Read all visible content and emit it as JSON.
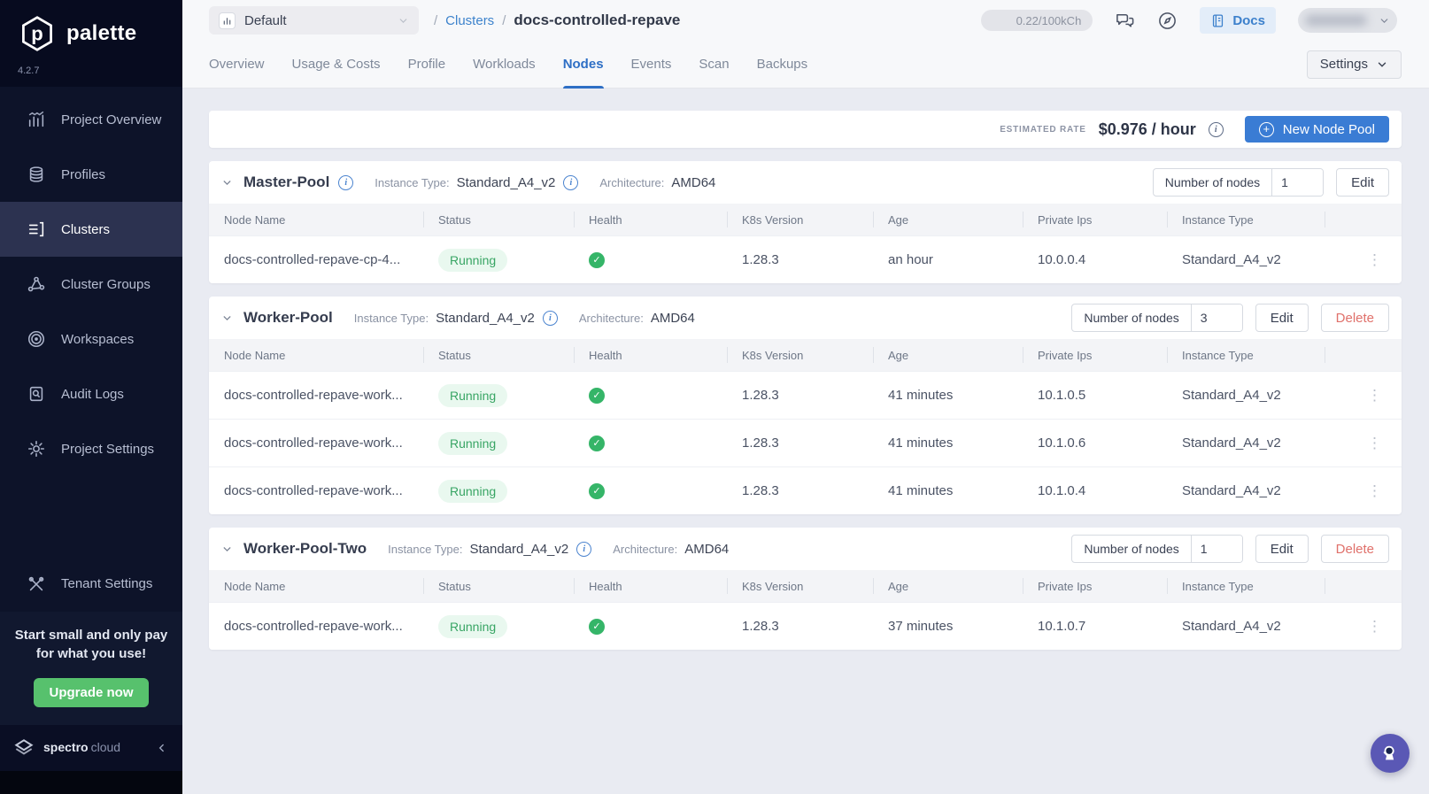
{
  "app": {
    "name": "palette",
    "version": "4.2.7"
  },
  "sidebar": {
    "items": [
      {
        "label": "Project Overview"
      },
      {
        "label": "Profiles"
      },
      {
        "label": "Clusters"
      },
      {
        "label": "Cluster Groups"
      },
      {
        "label": "Workspaces"
      },
      {
        "label": "Audit Logs"
      },
      {
        "label": "Project Settings"
      },
      {
        "label": "Tenant Settings"
      }
    ],
    "active_item": "Clusters",
    "upsell": {
      "text": "Start small and only pay for what you use!",
      "button": "Upgrade now"
    },
    "footer": {
      "brand_primary": "spectro",
      "brand_secondary": "cloud"
    }
  },
  "topbar": {
    "project_selector": {
      "value": "Default"
    },
    "breadcrumb": {
      "slash": "/",
      "root": "Clusters",
      "current": "docs-controlled-repave"
    },
    "usage_badge": "0.22/100kCh",
    "docs_button": "Docs",
    "settings_button": "Settings"
  },
  "tabs": {
    "items": [
      "Overview",
      "Usage & Costs",
      "Profile",
      "Workloads",
      "Nodes",
      "Events",
      "Scan",
      "Backups"
    ],
    "active": "Nodes"
  },
  "rate_bar": {
    "label": "ESTIMATED RATE",
    "value": "$0.976 / hour",
    "new_pool_button": "New Node Pool"
  },
  "table": {
    "headers": [
      "Node Name",
      "Status",
      "Health",
      "K8s Version",
      "Age",
      "Private Ips",
      "Instance Type"
    ]
  },
  "pools": [
    {
      "name": "Master-Pool",
      "instance_type_label": "Instance Type:",
      "instance_type": "Standard_A4_v2",
      "architecture_label": "Architecture:",
      "architecture": "AMD64",
      "nodes_label": "Number of nodes",
      "nodes_value": "1",
      "edit_button": "Edit",
      "rows": [
        {
          "name": "docs-controlled-repave-cp-4...",
          "status": "Running",
          "health": "healthy",
          "k8s_version": "1.28.3",
          "age": "an hour",
          "private_ip": "10.0.0.4",
          "instance_type": "Standard_A4_v2"
        }
      ]
    },
    {
      "name": "Worker-Pool",
      "instance_type_label": "Instance Type:",
      "instance_type": "Standard_A4_v2",
      "architecture_label": "Architecture:",
      "architecture": "AMD64",
      "nodes_label": "Number of nodes",
      "nodes_value": "3",
      "edit_button": "Edit",
      "delete_button": "Delete",
      "rows": [
        {
          "name": "docs-controlled-repave-work...",
          "status": "Running",
          "health": "healthy",
          "k8s_version": "1.28.3",
          "age": "41 minutes",
          "private_ip": "10.1.0.5",
          "instance_type": "Standard_A4_v2"
        },
        {
          "name": "docs-controlled-repave-work...",
          "status": "Running",
          "health": "healthy",
          "k8s_version": "1.28.3",
          "age": "41 minutes",
          "private_ip": "10.1.0.6",
          "instance_type": "Standard_A4_v2"
        },
        {
          "name": "docs-controlled-repave-work...",
          "status": "Running",
          "health": "healthy",
          "k8s_version": "1.28.3",
          "age": "41 minutes",
          "private_ip": "10.1.0.4",
          "instance_type": "Standard_A4_v2"
        }
      ]
    },
    {
      "name": "Worker-Pool-Two",
      "instance_type_label": "Instance Type:",
      "instance_type": "Standard_A4_v2",
      "architecture_label": "Architecture:",
      "architecture": "AMD64",
      "nodes_label": "Number of nodes",
      "nodes_value": "1",
      "edit_button": "Edit",
      "delete_button": "Delete",
      "rows": [
        {
          "name": "docs-controlled-repave-work...",
          "status": "Running",
          "health": "healthy",
          "k8s_version": "1.28.3",
          "age": "37 minutes",
          "private_ip": "10.1.0.7",
          "instance_type": "Standard_A4_v2"
        }
      ]
    }
  ],
  "icons": {
    "health_ok": "check-circle",
    "row_menu": "kebab-vertical",
    "fab": "astronaut"
  },
  "colors": {
    "accent_blue": "#3a7cd4",
    "running_green": "#38a564",
    "health_green": "#35b568",
    "delete_red": "#e0716b",
    "upgrade_green": "#57c16d",
    "fab_purple": "#5a58b5",
    "sidebar_bg": "#0d1329"
  }
}
